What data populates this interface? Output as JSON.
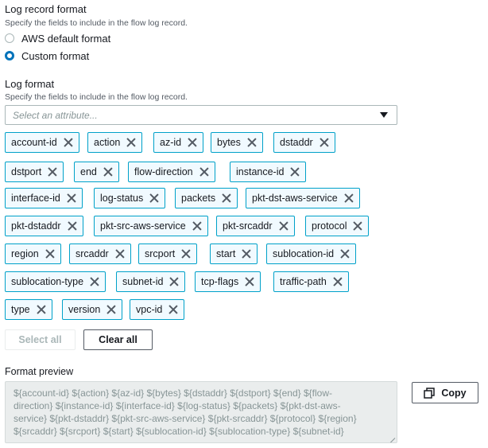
{
  "log_record_format": {
    "title": "Log record format",
    "description": "Specify the fields to include in the flow log record.",
    "options": [
      {
        "label": "AWS default format",
        "checked": false
      },
      {
        "label": "Custom format",
        "checked": true
      }
    ]
  },
  "log_format": {
    "title": "Log format",
    "description": "Specify the fields to include in the flow log record.",
    "select_placeholder": "Select an attribute..."
  },
  "tokens": [
    "account-id",
    "action",
    "az-id",
    "bytes",
    "dstaddr",
    "dstport",
    "end",
    "flow-direction",
    "instance-id",
    "interface-id",
    "log-status",
    "packets",
    "pkt-dst-aws-service",
    "pkt-dstaddr",
    "pkt-src-aws-service",
    "pkt-srcaddr",
    "protocol",
    "region",
    "srcaddr",
    "srcport",
    "start",
    "sublocation-id",
    "sublocation-type",
    "subnet-id",
    "tcp-flags",
    "traffic-path",
    "type",
    "version",
    "vpc-id"
  ],
  "buttons": {
    "select_all": "Select all",
    "clear_all": "Clear all",
    "copy": "Copy"
  },
  "format_preview": {
    "title": "Format preview",
    "lines": [
      "${account-id} ${action} ${az-id} ${bytes} ${dstaddr} ${dstport} ${end} ${flow-",
      "direction} ${instance-id} ${interface-id} ${log-status} ${packets} ${pkt-dst-aws-",
      "service} ${pkt-dstaddr} ${pkt-src-aws-service} ${pkt-srcaddr} ${protocol} ${region}",
      "${srcaddr} ${srcport} ${start} ${sublocation-id} ${sublocation-type} ${subnet-id}"
    ]
  },
  "colors": {
    "accent": "#0073bb",
    "token_border": "#00a1c9",
    "token_bg": "#f1faff"
  }
}
